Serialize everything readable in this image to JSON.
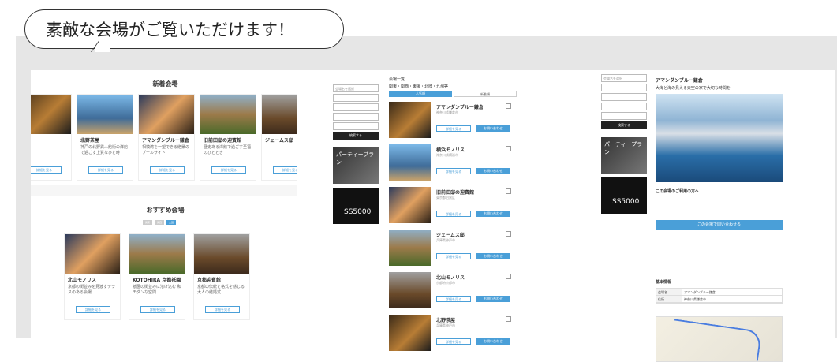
{
  "headline": "素敵な会場がご覧いただけます！",
  "shot1": {
    "section_new": "新着会場",
    "new_cards": [
      {
        "name": "",
        "desc": ""
      },
      {
        "name": "北野茶屋",
        "desc": "神戸の北野異人館街の洋館で過ごす上質なひと時"
      },
      {
        "name": "アマンダンブルー鎌倉",
        "desc": "相模湾を一望できる絶景のプールサイド"
      },
      {
        "name": "旧前田邸の迎賓館",
        "desc": "歴史ある洋館で過ごす至福のひととき"
      },
      {
        "name": "ジェームス邸",
        "desc": ""
      }
    ],
    "card_button": "詳細を見る",
    "section_rec": "おすすめ会場",
    "rec_tabs": [
      "関東",
      "関西",
      "全国"
    ],
    "rec_cards": [
      {
        "name": "北山モノリス",
        "desc": "京都の街並みを見渡すテラスのある会場"
      },
      {
        "name": "KOTOHIRA 京都祇園",
        "desc": "祇園の街並みに溶け込む 和モダンな空間"
      },
      {
        "name": "京都迎賓館",
        "desc": "京都の伝統と格式を感じる大人の結婚式"
      }
    ]
  },
  "shot2": {
    "fields": [
      "会場名を選択",
      "",
      "",
      "",
      ""
    ],
    "search": "検索する",
    "banner1": "パーティープラン",
    "banner2": "SS5000",
    "breadcrumb": "会場一覧",
    "filter": "関東・関西・東海・北陸・九州等",
    "tabs": [
      "人気順",
      "新着順"
    ],
    "rows": [
      {
        "name": "アマンダンブルー鎌倉",
        "sub": "神奈川県鎌倉市"
      },
      {
        "name": "横浜モノリス",
        "sub": "神奈川県横浜市"
      },
      {
        "name": "旧前田邸の迎賓館",
        "sub": "東京都目黒区"
      },
      {
        "name": "ジェームス邸",
        "sub": "兵庫県神戸市"
      },
      {
        "name": "北山モノリス",
        "sub": "京都府京都市"
      },
      {
        "name": "北野茶屋",
        "sub": "兵庫県神戸市"
      }
    ],
    "btn_detail": "詳細を見る",
    "btn_contact": "お問い合わせ"
  },
  "shot3": {
    "fields": [
      "会場名を選択",
      "",
      "",
      "",
      ""
    ],
    "search": "検索する",
    "banner1": "パーティープラン",
    "banner2": "SS5000",
    "title": "アマンダンブルー鎌倉",
    "catch": "大海と海の見える天空の家で大切な時間を",
    "section": "この会場のご利用の方へ",
    "cta": "この会場で問い合わせる",
    "basic": "基本情報",
    "table": [
      {
        "k": "会場名",
        "v": "アマンダンブルー鎌倉"
      },
      {
        "k": "住所",
        "v": "神奈川県鎌倉市"
      }
    ]
  }
}
